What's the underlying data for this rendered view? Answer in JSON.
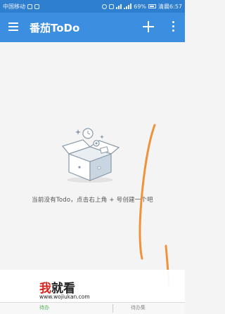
{
  "status_bar": {
    "carrier": "中国移动",
    "battery": "69%",
    "time": "清晨6:57"
  },
  "app_bar": {
    "title": "番茄ToDo",
    "icons": [
      "menu-icon",
      "add-icon",
      "more-vert-icon"
    ]
  },
  "empty_state": {
    "message": "当前没有Todo，点击右上角 + 号创建一个吧",
    "illustration": "open-box-icon"
  },
  "watermark": {
    "logo_part1": "我",
    "logo_part2": "就看",
    "url": "www.wojiukan.com"
  },
  "bottom_bar": {
    "left_label": "待办",
    "right_label": "待办集"
  },
  "colors": {
    "app_bar": "#3b8ee0",
    "status_bar": "#2f7fd0",
    "background": "#f4f4f4",
    "annotation_stroke": "#f0923a",
    "logo_red": "#d9231a"
  }
}
